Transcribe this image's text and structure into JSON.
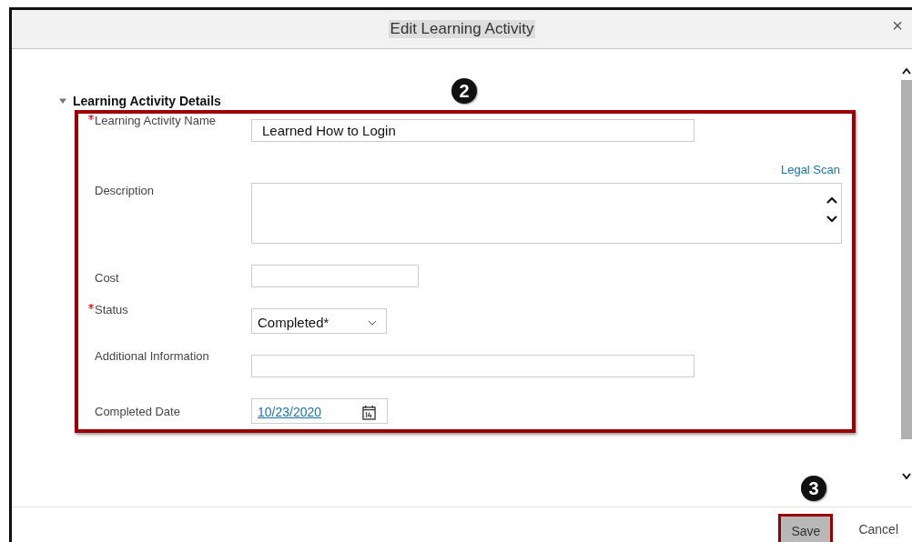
{
  "dialog": {
    "title": "Edit Learning Activity",
    "close": "×"
  },
  "section": {
    "title": "Learning Activity Details",
    "expanded": true
  },
  "fields": [
    {
      "kind": "text",
      "label": "Learning Activity Name",
      "required": true,
      "value": "Learned How to Login"
    },
    {
      "kind": "textarea",
      "label": "Description",
      "required": false,
      "link": "Legal Scan"
    },
    {
      "kind": "short",
      "label": "Cost",
      "required": false
    },
    {
      "kind": "select",
      "label": "Status",
      "required": true,
      "value": "Completed*"
    },
    {
      "kind": "text",
      "label": "Additional Information",
      "required": false
    },
    {
      "kind": "date",
      "label": "Completed Date",
      "required": false,
      "value": "10/23/2020"
    }
  ],
  "buttons": [
    {
      "label": "Save",
      "highlighted": true
    },
    {
      "label": "Cancel",
      "highlighted": false
    }
  ],
  "callouts": [
    "2",
    "3"
  ]
}
